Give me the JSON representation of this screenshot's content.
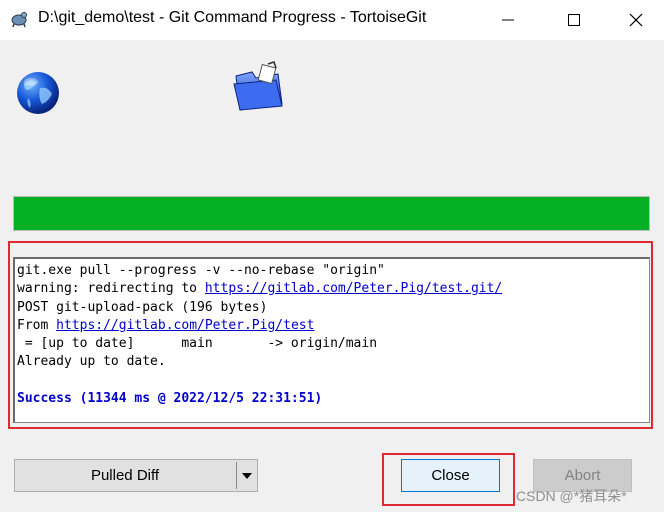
{
  "window": {
    "title": "D:\\git_demo\\test - Git Command Progress - TortoiseGit",
    "app_icon": "tortoisegit-icon",
    "controls": [
      "minimize-icon",
      "maximize-icon",
      "close-icon"
    ]
  },
  "icons": {
    "globe": "globe-icon",
    "folder": "folder-icon"
  },
  "progress": {
    "fraction": 1.0,
    "color": "#06b025"
  },
  "log": {
    "command": "git.exe pull --progress -v --no-rebase \"origin\"",
    "warning_prefix": "warning: redirecting to ",
    "warning_link": "https://gitlab.com/Peter.Pig/test.git/",
    "post_line": "POST git-upload-pack (196 bytes)",
    "from_prefix": "From ",
    "from_link": "https://gitlab.com/Peter.Pig/test",
    "update_line": " = [up to date]      main       -> origin/main",
    "status_line": "Already up to date.",
    "success_line": "Success (11344 ms @ 2022/12/5 22:31:51)"
  },
  "buttons": {
    "pulled_diff": "Pulled Diff",
    "close": "Close",
    "abort": "Abort"
  },
  "colors": {
    "highlight_frame": "#e0292f",
    "link": "#0000cc",
    "accent": "#0078d7"
  },
  "watermark": "CSDN @*猪耳朵*"
}
